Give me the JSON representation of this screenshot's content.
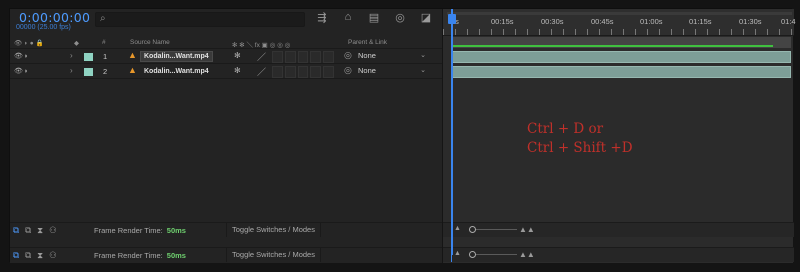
{
  "window": {
    "timecode": "0:00:00:00",
    "fps": "00000 (25.00 fps)",
    "search_icon": "search-icon",
    "toolbar_icons": [
      "composition-flowchart-icon",
      "draft-3d-icon",
      "frame-blending-icon",
      "motion-blur-icon",
      "graph-editor-icon"
    ]
  },
  "columns": {
    "source_name": "Source Name",
    "num": "#",
    "parent_link": "Parent & Link"
  },
  "layers": [
    {
      "num": "1",
      "name": "Kodalin...Want.mp4",
      "parent": "None",
      "label_color": "#8fd3c2"
    },
    {
      "num": "2",
      "name": "Kodalin...Want.mp4",
      "parent": "None",
      "label_color": "#8fd3c2"
    }
  ],
  "ruler": {
    "ticks": [
      "0s",
      "00:15s",
      "00:30s",
      "00:45s",
      "01:00s",
      "01:15s",
      "01:30s",
      "01:4"
    ]
  },
  "annotation": {
    "line1": "Ctrl + D or",
    "line2": "Ctrl + Shift +D"
  },
  "status": {
    "frame_render_label": "Frame Render Time:",
    "frame_render_value": "50ms",
    "toggle_label": "Toggle Switches / Modes"
  },
  "colors": {
    "accent": "#3a85ef",
    "annotation": "#c0302a",
    "label": "#8fd3c2",
    "render_time": "#6fd06f"
  }
}
